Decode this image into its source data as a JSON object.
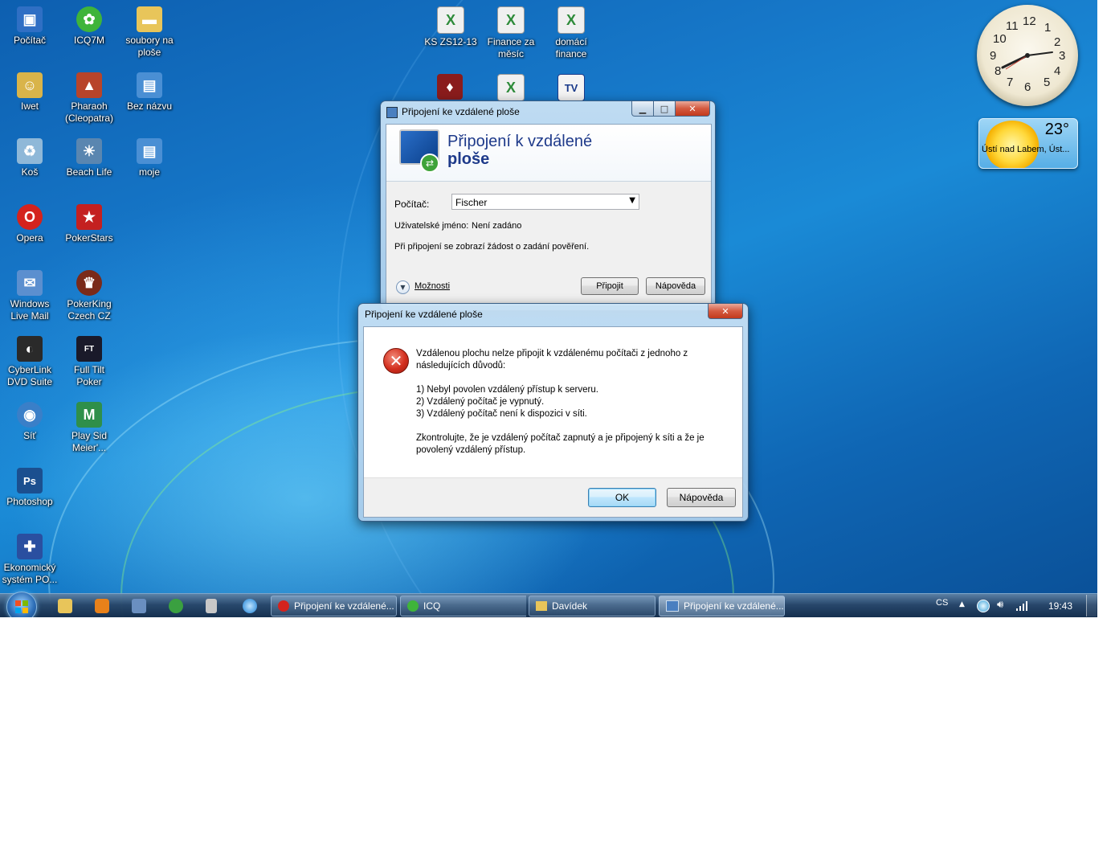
{
  "desktop": {
    "icons": [
      {
        "label": "Počítač",
        "icon": "computer-icon",
        "color": "#2f6fc4"
      },
      {
        "label": "ICQ7M",
        "icon": "icq-flower-icon",
        "color": "#3fb43a"
      },
      {
        "label": "soubory na ploše",
        "icon": "folder-icon",
        "color": "#e8c55a"
      },
      {
        "label": "KS ZS12-13",
        "icon": "excel-file-icon",
        "color": "#2e8b3a"
      },
      {
        "label": "Finance za měsíc",
        "icon": "excel-file-icon",
        "color": "#2e8b3a"
      },
      {
        "label": "domácí finance",
        "icon": "excel-file-icon",
        "color": "#2e8b3a"
      },
      {
        "label": "Iwet",
        "icon": "user-folder-icon",
        "color": "#d9b44a"
      },
      {
        "label": "Pharaoh (Cleopatra)",
        "icon": "pharaoh-game-icon",
        "color": "#b8442a"
      },
      {
        "label": "Bez názvu",
        "icon": "image-file-icon",
        "color": "#4a8fd4"
      },
      {
        "label": "Koš",
        "icon": "recycle-bin-icon",
        "color": "#8fb8d8"
      },
      {
        "label": "Beach Life",
        "icon": "beach-life-game-icon",
        "color": "#5a86b0"
      },
      {
        "label": "moje",
        "icon": "image-file-icon",
        "color": "#4a8fd4"
      },
      {
        "label": "Opera",
        "icon": "opera-icon",
        "color": "#d4231d"
      },
      {
        "label": "PokerStars",
        "icon": "pokerstars-icon",
        "color": "#c42020"
      },
      {
        "label": "Windows Live Mail",
        "icon": "mail-icon",
        "color": "#5b8fcf"
      },
      {
        "label": "PokerKing Czech CZ",
        "icon": "pokerking-icon",
        "color": "#7a2a1a"
      },
      {
        "label": "CyberLink DVD Suite",
        "icon": "cyberlink-icon",
        "color": "#2a2a2a"
      },
      {
        "label": "Full Tilt Poker",
        "icon": "full-tilt-icon",
        "color": "#1a1a2a"
      },
      {
        "label": "Síť",
        "icon": "network-icon",
        "color": "#3a7fc8"
      },
      {
        "label": "Play Sid Meier'...",
        "icon": "sid-meier-game-icon",
        "color": "#2f8f4a"
      },
      {
        "label": "Photoshop",
        "icon": "photoshop-icon",
        "color": "#1b4f8f"
      },
      {
        "label": "Ekonomický systém PO...",
        "icon": "economic-system-icon",
        "color": "#2a4fa0"
      }
    ],
    "extra_icons_unlabeled": [
      "game-icon-red",
      "excel-file-icon",
      "video-tv-icon"
    ]
  },
  "gadgets": {
    "clock_numbers": [
      "12",
      "1",
      "2",
      "3",
      "4",
      "5",
      "6",
      "7",
      "8",
      "9",
      "10",
      "11"
    ],
    "weather": {
      "temp": "23°",
      "location": "Ústí nad Labem, Úst..."
    }
  },
  "rdp_window": {
    "title": "Připojení ke vzdálené ploše",
    "header_line1": "Připojení k vzdálené",
    "header_line2": "ploše",
    "computer_label": "Počítač:",
    "computer_value": "Fischer",
    "username_label": "Uživatelské jméno:",
    "username_value": "Není zadáno",
    "credentials_note": "Při připojení se zobrazí žádost o zadání pověření.",
    "options_label": "Možnosti",
    "connect_button": "Připojit",
    "help_button": "Nápověda"
  },
  "error_dialog": {
    "title": "Připojení ke vzdálené ploše",
    "message_intro": "Vzdálenou plochu nelze připojit k vzdálenému počítači z jednoho z následujících důvodů:",
    "reasons": [
      "1) Nebyl povolen vzdálený přístup k serveru.",
      "2) Vzdálený počítač je vypnutý.",
      "3) Vzdálený počítač není k dispozici v síti."
    ],
    "message_outro": "Zkontrolujte, že je vzdálený počítač zapnutý a je připojený k síti a že je povolený vzdálený přístup.",
    "ok_button": "OK",
    "help_button": "Nápověda"
  },
  "taskbar": {
    "quick_launch": [
      "explorer-icon",
      "media-player-icon",
      "task-icon",
      "games-icon",
      "calculator-icon",
      "internet-explorer-icon"
    ],
    "buttons": [
      {
        "label": "Připojení ke vzdálené...",
        "icon": "opera-icon"
      },
      {
        "label": "ICQ",
        "icon": "icq-flower-icon"
      },
      {
        "label": "Davídek",
        "icon": "folder-icon"
      },
      {
        "label": "Připojení ke vzdálené...",
        "icon": "remote-desktop-icon"
      }
    ],
    "language": "CS",
    "time": "19:43"
  }
}
